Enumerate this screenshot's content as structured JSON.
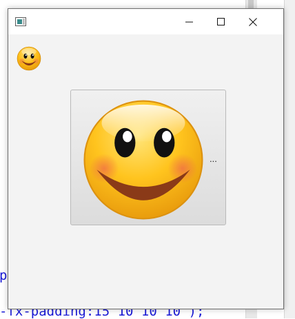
{
  "background_editor": {
    "code_lines": [
      "pa",
      "-fx-padding:15 10 10 10 );"
    ]
  },
  "window": {
    "title": "",
    "controls": {
      "minimize_icon": "minimize-icon",
      "maximize_icon": "maximize-icon",
      "close_icon": "close-icon"
    }
  },
  "content": {
    "small_graphic": "smiley-emoji",
    "button": {
      "graphic": "smiley-emoji",
      "label": "..."
    }
  },
  "colors": {
    "face": "#ffc01a",
    "mouth": "#8a3a18",
    "cheek": "#f07a4a",
    "window_bg": "#f3f3f3",
    "code_text": "#1a1ad6"
  }
}
